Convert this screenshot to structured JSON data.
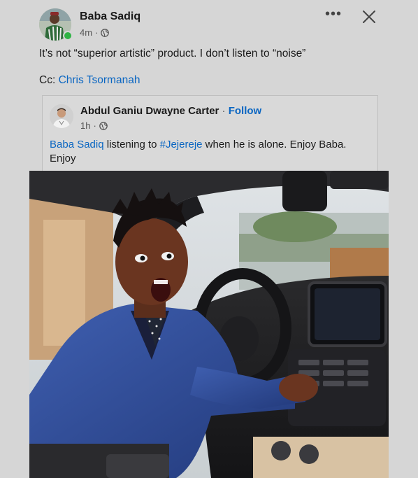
{
  "post": {
    "author": "Baba Sadiq",
    "time": "4m",
    "meta_sep": "·",
    "text": "It’s not “superior artistic” product. I don’t listen to “noise”",
    "cc_prefix": "Cc:",
    "cc_mention": "Chris Tsormanah",
    "more_label": "•••"
  },
  "shared": {
    "author": "Abdul Ganiu Dwayne Carter",
    "separator": "·",
    "follow": "Follow",
    "time": "1h",
    "meta_sep": "·",
    "mention": "Baba Sadiq",
    "text_a": " listening to ",
    "hashtag": "#Jejereje",
    "text_b": " when he is alone. Enjoy Baba. Enjoy"
  },
  "icons": {
    "globe": "globe-icon",
    "close": "close-icon",
    "more": "more-icon"
  },
  "colors": {
    "link": "#0a66c2",
    "online": "#2fb344",
    "background": "#d6d6d6"
  }
}
